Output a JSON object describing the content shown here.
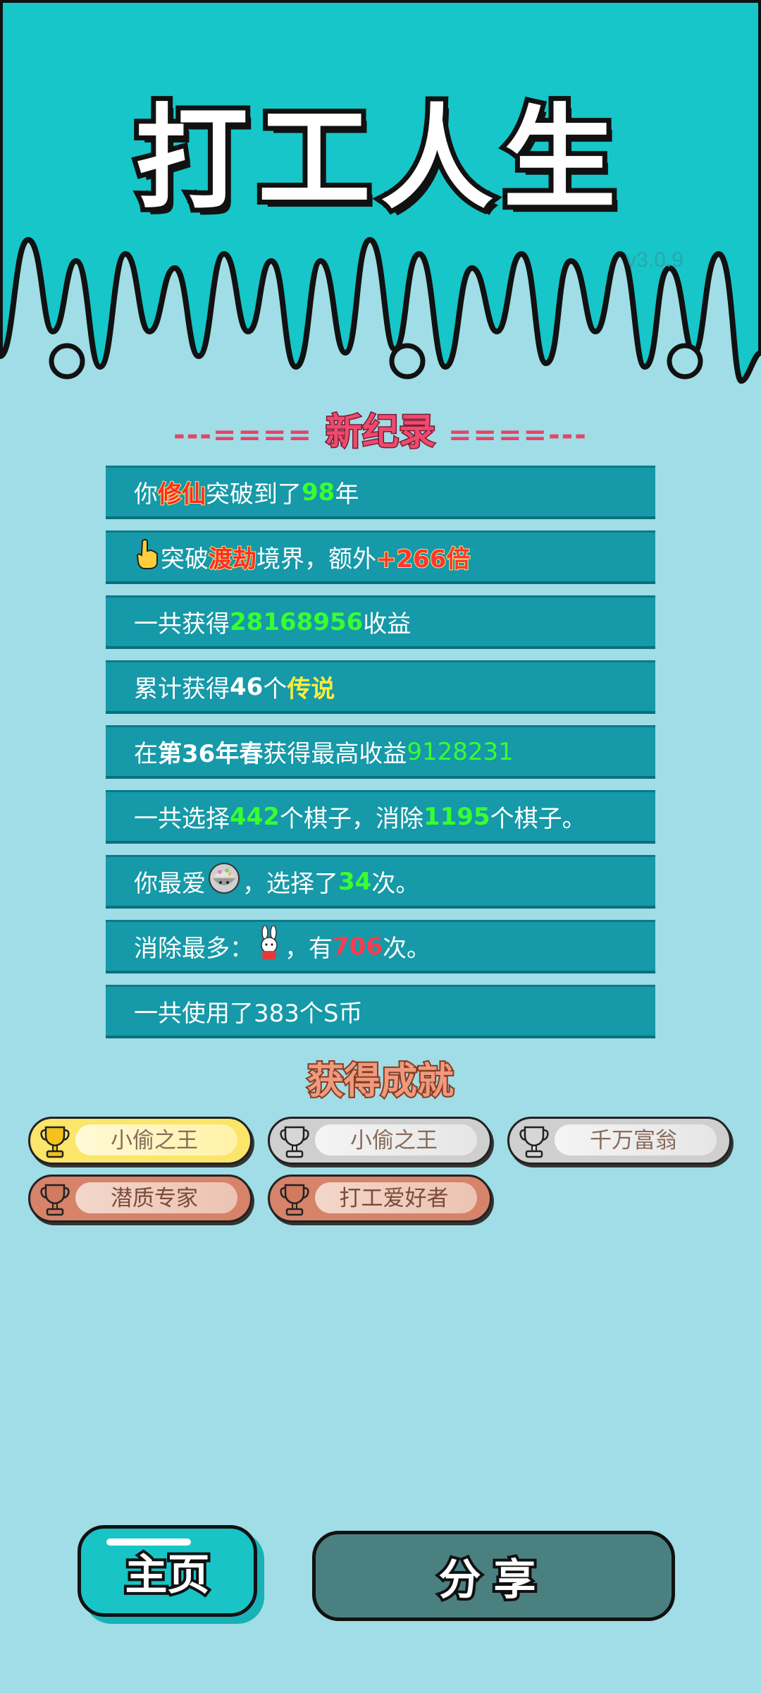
{
  "app": {
    "title": "打工人生",
    "version": "v3.0.9"
  },
  "record": {
    "title": "新纪录",
    "deco_left": "---====",
    "deco_right": "====---"
  },
  "stats": [
    {
      "p1": "你",
      "hl1": "修仙",
      "p2": "突破到了",
      "hl2": "98",
      "p3": "年"
    },
    {
      "p1": "突破",
      "hl1": "渡劫",
      "p2": "境界，额外",
      "hl2": "+266倍"
    },
    {
      "p1": "一共获得",
      "hl1": "28168956",
      "p2": "收益"
    },
    {
      "p1": "累计获得",
      "hl1": "46",
      "p2": "个",
      "hl2": "传说"
    },
    {
      "p1": "在 ",
      "hl1": "第36年春",
      "p2": " 获得最高收益",
      "hl2": "9128231"
    },
    {
      "p1": "一共选择",
      "hl1": "442",
      "p2": "个棋子，消除",
      "hl2": "1195",
      "p3": "个棋子。"
    },
    {
      "p1": "你最爱",
      "p2": "，选择了",
      "hl1": "34",
      "p3": "次。"
    },
    {
      "p1": "消除最多：",
      "p2": "，有",
      "hl1": "706",
      "p3": "次。"
    },
    {
      "p1": "一共使用了383个S币"
    }
  ],
  "achievements": {
    "title": "获得成就",
    "items": [
      {
        "label": "小偷之王",
        "tier": "gold"
      },
      {
        "label": "小偷之王",
        "tier": "silver"
      },
      {
        "label": "千万富翁",
        "tier": "silver"
      },
      {
        "label": "潜质专家",
        "tier": "bronze"
      },
      {
        "label": "打工爱好者",
        "tier": "bronze"
      }
    ]
  },
  "buttons": {
    "home": "主页",
    "share": "分享"
  },
  "colors": {
    "header_bg": "#16c6c8",
    "page_bg": "#a0dde6",
    "row_bg": "#1699a8",
    "share_button": "#4a8180"
  }
}
